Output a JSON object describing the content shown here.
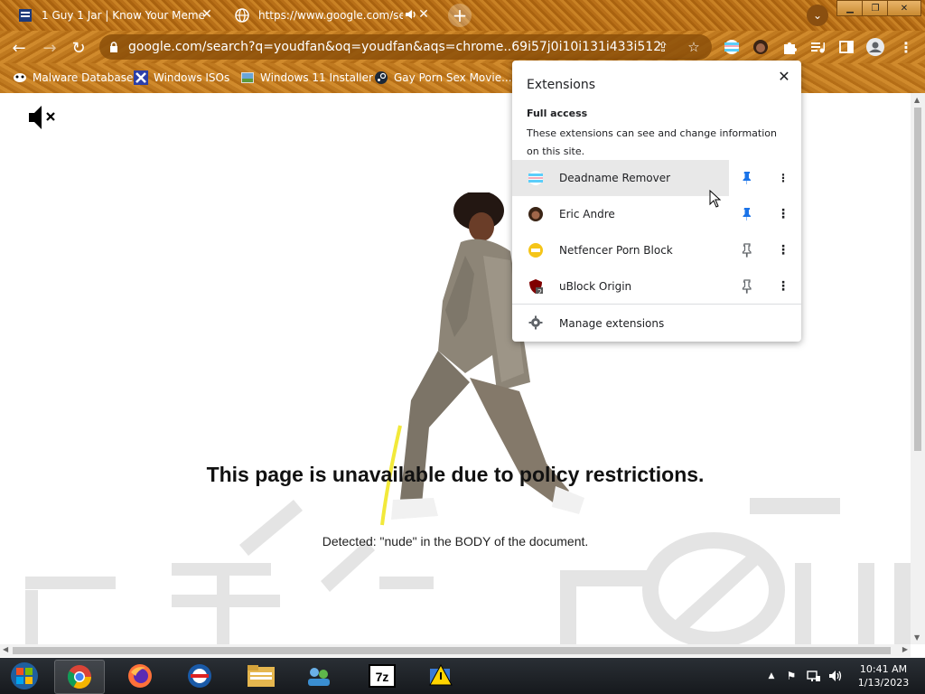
{
  "tabs": [
    {
      "title": "1 Guy 1 Jar | Know Your Meme",
      "active": false
    },
    {
      "title": "https://www.google.com/sear",
      "active": true,
      "audio": true
    }
  ],
  "omnibox": {
    "url": "google.com/search?q=youdfan&oq=youdfan&aqs=chrome..69i57j0i10i131i433i512l2j0i1..."
  },
  "bookmarks": [
    {
      "label": "Malware Database",
      "icon": "mask-icon"
    },
    {
      "label": "Windows ISOs",
      "icon": "x-icon"
    },
    {
      "label": "Windows 11 Installer",
      "icon": "image-icon"
    },
    {
      "label": "Gay Porn Sex Movie...",
      "icon": "steam-icon"
    }
  ],
  "page": {
    "title": "This page is unavailable due to policy restrictions.",
    "detail": "Detected: \"nude\" in the BODY of the document."
  },
  "extensions_popup": {
    "title": "Extensions",
    "access_title": "Full access",
    "access_desc": "These extensions can see and change information on this site.",
    "items": [
      {
        "name": "Deadname Remover",
        "pinned": true
      },
      {
        "name": "Eric Andre",
        "pinned": true
      },
      {
        "name": "Netfencer Porn Block",
        "pinned": false
      },
      {
        "name": "uBlock Origin",
        "pinned": false,
        "badge": "2"
      }
    ],
    "manage_label": "Manage extensions"
  },
  "taskbar": {
    "apps": [
      "start-orb",
      "chrome",
      "firefox",
      "opera",
      "file-explorer",
      "network",
      "7zip",
      "app"
    ],
    "time": "10:41 AM",
    "date": "1/13/2023"
  },
  "colors": {
    "theme_brown": "#c07a20",
    "pin_blue": "#1a73e8"
  }
}
